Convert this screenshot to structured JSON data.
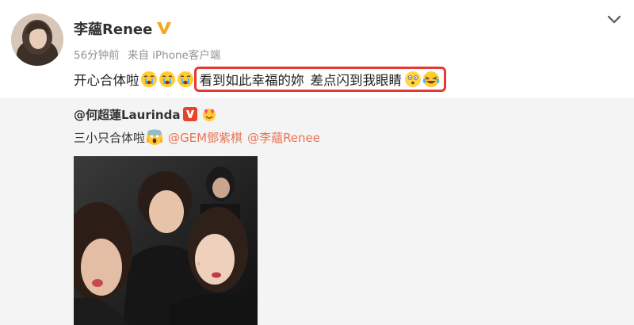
{
  "post": {
    "author": "李蘊Renee",
    "time": "56分钟前",
    "source": "来自 iPhone客户端",
    "text_before": "开心合体啦",
    "highlight_text_1": "看到如此幸福的妳",
    "highlight_text_2": "差点闪到我眼睛",
    "emojis_before": [
      "crying-face-icon",
      "crying-face-icon",
      "crying-face-icon"
    ],
    "emojis_after": [
      "dizzy-face-icon",
      "laughing-tears-icon"
    ]
  },
  "repost": {
    "author": "@何超蓮Laurinda",
    "text": "三小只合体啦",
    "mentions": [
      "@GEM鄧紫棋",
      "@李蘊Renee"
    ],
    "badges": [
      "verified-v-icon",
      "hearts-icon"
    ]
  },
  "colors": {
    "accent": "#eb7350",
    "highlight_border": "#e53935",
    "badge_gold": "#f5a623",
    "repost_bg": "#f4f4f4",
    "meta_text": "#939393"
  }
}
